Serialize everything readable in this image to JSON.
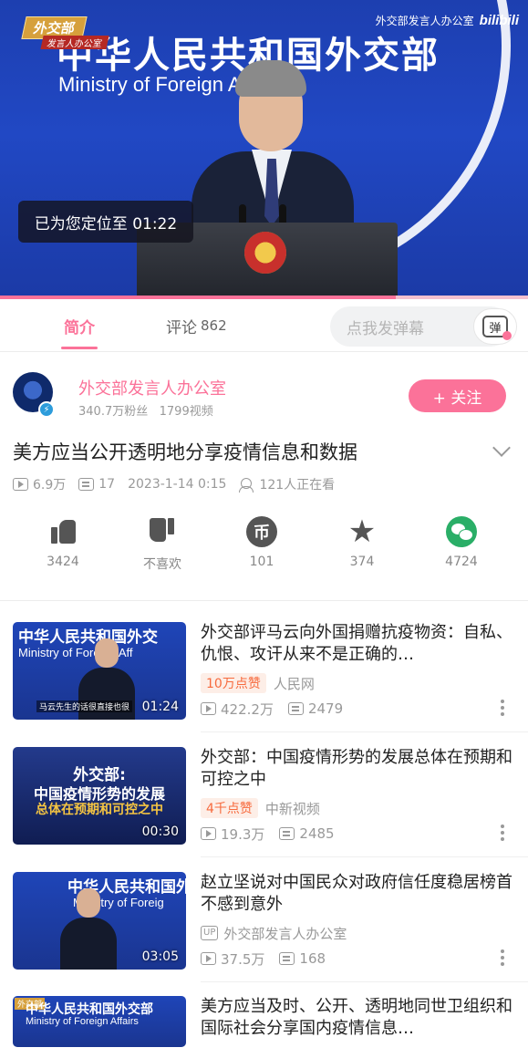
{
  "player": {
    "ministry_cn": "中华人民共和国外交部",
    "ministry_en": "Ministry of Foreign Affairs",
    "badge_main": "外交部",
    "badge_sub": "发言人办公室",
    "watermark_text": "外交部发言人办公室",
    "watermark_logo": "bilibili",
    "locate_toast": "已为您定位至 01:22",
    "progress": 0.75,
    "accent_color": "#fb7299"
  },
  "tabs": {
    "intro_label": "简介",
    "comments_label": "评论",
    "comments_count": "862",
    "danmaku_placeholder": "点我发弹幕",
    "danmaku_icon_text": "弹"
  },
  "uploader": {
    "name": "外交部发言人办公室",
    "fans": "340.7万粉丝",
    "videos": "1799视频",
    "follow_label": "+ 关注"
  },
  "video": {
    "title": "美方应当公开透明地分享疫情信息和数据",
    "views": "6.9万",
    "danmaku": "17",
    "date": "2023-1-14 0:15",
    "watching": "121人正在看"
  },
  "actions": {
    "like": "3424",
    "dislike": "不喜欢",
    "coin": "101",
    "coin_glyph": "币",
    "favorite": "374",
    "share": "4724"
  },
  "related": [
    {
      "title": "外交部评马云向外国捐赠抗疫物资：自私、仇恨、攻讦从来不是正确的…",
      "thumb_cn": "中华人民共和国外交",
      "thumb_en": "Ministry of Foreign Aff",
      "thumb_sub": "马云先生的话很直接也很",
      "duration": "01:24",
      "hot": "10万点赞",
      "source": "人民网",
      "views": "422.2万",
      "danmaku": "2479"
    },
    {
      "title": "外交部：中国疫情形势的发展总体在预期和可控之中",
      "thumb_line1": "外交部:",
      "thumb_line2": "中国疫情形势的发展",
      "thumb_line3": "总体在预期和可控之中",
      "duration": "00:30",
      "hot": "4千点赞",
      "source": "中新视频",
      "views": "19.3万",
      "danmaku": "2485"
    },
    {
      "title": "赵立坚说对中国民众对政府信任度稳居榜首不感到意外",
      "thumb_cn": "中华人民共和国外",
      "thumb_en": "Ministry of Foreig",
      "duration": "03:05",
      "up_tag": "UP",
      "source": "外交部发言人办公室",
      "views": "37.5万",
      "danmaku": "168"
    },
    {
      "title": "美方应当及时、公开、透明地同世卫组织和国际社会分享国内疫情信息…",
      "thumb_badge": "外交部",
      "thumb_cn": "中华人民共和国外交部",
      "thumb_en": "Ministry of Foreign Affairs"
    }
  ]
}
